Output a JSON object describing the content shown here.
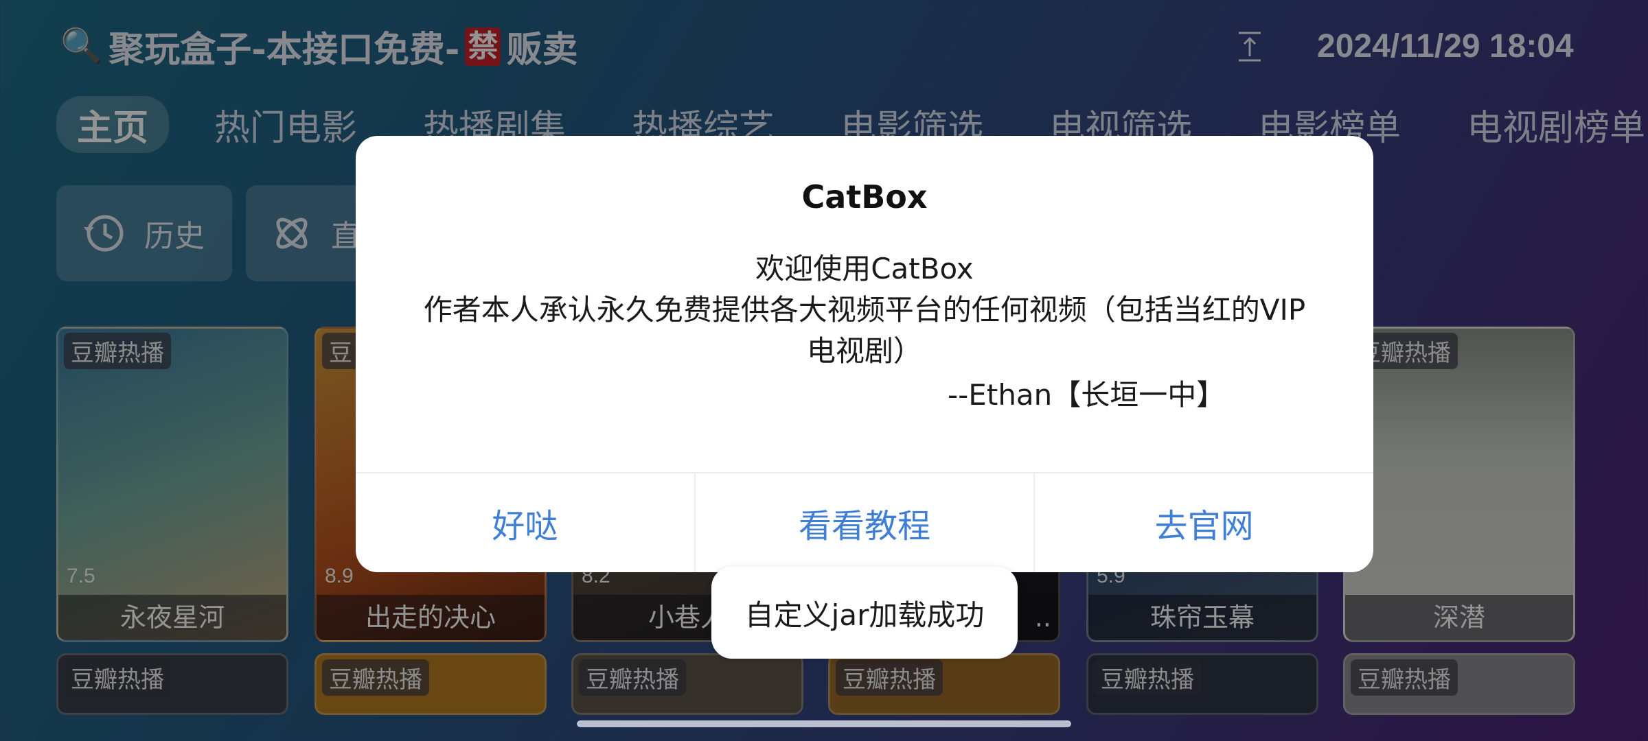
{
  "header": {
    "title_prefix": "聚玩盒子-本接口免费-",
    "banned_char": "禁",
    "title_suffix": "贩卖",
    "datetime": "2024/11/29 18:04"
  },
  "tabs": [
    "主页",
    "热门电影",
    "热播剧集",
    "热播综艺",
    "电影筛选",
    "电视筛选",
    "电影榜单",
    "电视剧榜单"
  ],
  "quick_buttons": {
    "history": "历史",
    "live": "直"
  },
  "cards_row1": [
    {
      "tag": "豆瓣热播",
      "rating": "7.5",
      "name": "永夜星河"
    },
    {
      "tag": "豆",
      "rating": "8.9",
      "name": "出走的决心"
    },
    {
      "tag": "",
      "rating": "8.2",
      "name": "小巷人"
    },
    {
      "tag": "",
      "rating": "",
      "name": ".."
    },
    {
      "tag": "",
      "rating": "5.9",
      "name": "珠帘玉幕"
    },
    {
      "tag": "豆瓣热播",
      "rating": "",
      "name": "深潜"
    }
  ],
  "cards_row2": [
    "豆瓣热播",
    "豆瓣热播",
    "豆瓣热播",
    "豆瓣热播",
    "豆瓣热播",
    "豆瓣热播"
  ],
  "dialog": {
    "title": "CatBox",
    "line1": "欢迎使用CatBox",
    "line2": "作者本人承认永久免费提供各大视频平台的任何视频（包括当红的VIP电视剧）",
    "signature": "--Ethan【长垣一中】",
    "buttons": [
      "好哒",
      "看看教程",
      "去官网"
    ]
  },
  "toast": "自定义jar加载成功",
  "colors": {
    "accent": "#3f7fd6",
    "ban": "#c9242a"
  }
}
